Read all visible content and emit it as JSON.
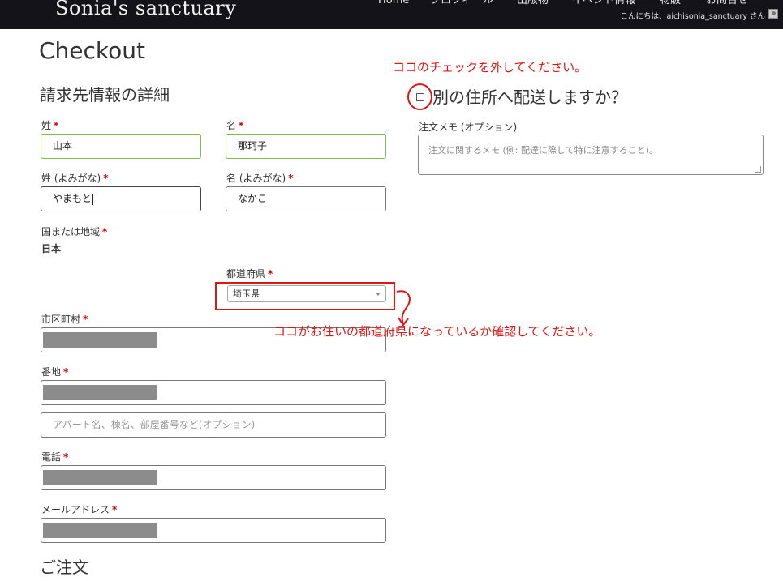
{
  "header": {
    "site_title": "Sonia's sanctuary",
    "nav": [
      "Home",
      "プロフィール",
      "出版物",
      "イベント情報",
      "物販",
      "お問合せ"
    ],
    "greeting": "こんにちは、aichisonia_sanctuary さん"
  },
  "page": {
    "title": "Checkout"
  },
  "billing": {
    "section_title": "請求先情報の詳細",
    "required_mark": "*",
    "last_name": {
      "label": "姓",
      "value": "山本"
    },
    "first_name": {
      "label": "名",
      "value": "那珂子"
    },
    "last_name_kana": {
      "label": "姓 (よみがな)",
      "value": "やまもと"
    },
    "first_name_kana": {
      "label": "名 (よみがな)",
      "value": "なかこ"
    },
    "country": {
      "label": "国または地域",
      "value": "日本"
    },
    "prefecture": {
      "label": "都道府県",
      "value": "埼玉県"
    },
    "city": {
      "label": "市区町村"
    },
    "address1": {
      "label": "番地"
    },
    "address2": {
      "placeholder": "アパート名、棟名、部屋番号など(オプション)"
    },
    "phone": {
      "label": "電話"
    },
    "email": {
      "label": "メールアドレス"
    }
  },
  "shipping": {
    "ship_different_label": "別の住所へ配送しますか？",
    "order_notes_label": "注文メモ (オプション)",
    "order_notes_placeholder": "注文に関するメモ (例: 配達に際して特に注意すること)。"
  },
  "order": {
    "section_title": "ご注文"
  },
  "annotations": {
    "checkbox_note": "ココのチェックを外してください。",
    "prefecture_note": "ココがお住いの都道府県になっているか確認してください。",
    "color": "#e01616"
  }
}
